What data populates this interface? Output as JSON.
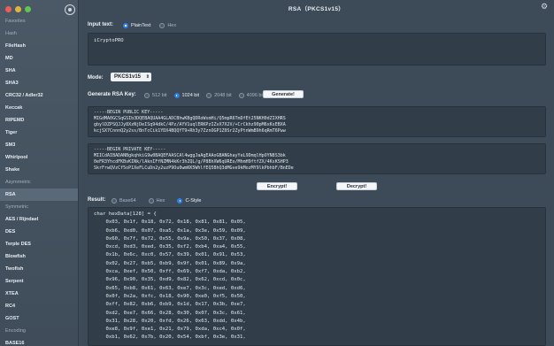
{
  "window": {
    "title": "RSA（PKCS1v15）"
  },
  "sidebar": {
    "sections": [
      {
        "label": "Favorites",
        "items": []
      },
      {
        "label": "Hash",
        "items": [
          "FileHash",
          "MD",
          "SHA",
          "SHA3",
          "CRC32 / Adler32",
          "Keccak",
          "RIPEMD",
          "Tiger",
          "SM3",
          "Whirlpool",
          "Shake"
        ]
      },
      {
        "label": "Asymmetric",
        "items": [
          "RSA"
        ]
      },
      {
        "label": "Symmetric",
        "items": [
          "AES / Rijndael",
          "DES",
          "Terple DES",
          "Blowfish",
          "Twofish",
          "Serpent",
          "XTEA",
          "RC4",
          "GOST"
        ]
      },
      {
        "label": "Encoding",
        "items": [
          "BASE16"
        ]
      }
    ],
    "active": "RSA"
  },
  "input": {
    "label": "Input text:",
    "options": [
      "PlainText",
      "Hex"
    ],
    "selected": "PlainText",
    "value": "iCryptoPRO"
  },
  "mode": {
    "label": "Mode:",
    "value": "PKCS1v15"
  },
  "generate": {
    "label": "Generate RSA Key:",
    "options": [
      "512 bit",
      "1024 bit",
      "2048 bit",
      "4096 bit"
    ],
    "selected": "1024 bit",
    "button": "Generate!"
  },
  "public_key": {
    "lines": [
      "-----BEGIN PUBLIC KEY-----",
      "MIGdMA0GCSqGSIb3DQEBAQUAA4GLADCBhwKBgQDRoWsmHi/Q5mpR6TmDfEt25NKH0dZIXHRS",
      "gbylDZPSQJJy8XzNjDeISq94dkC/4Pz/AYV1uqlERKPzIZvX7X2V/+CrCkhz90pM6xKsEBXA",
      "kcjSX7CnnnQ2y2ss/BnTcCik1YDX4BQQYT9+Rh3y7ZznOGP1Z0Sr2ZyPtnWmB9h6qRmT6Pww"
    ]
  },
  "private_key": {
    "lines": [
      "-----BEGIN PRIVATE KEY-----",
      "MIICdAIBADANBgkqhkiG9w0BAQEFAASCAl4wggJaAgEAAoGBANGhayYeL9DmqlHpOYN8S3bk",
      "0eFR3YhcdFKBvKINk/lAknIFfNZMN4kKr3hZQL/g/P8BhXW6qUREo/MhmH9ftfZX/4KsKSHP3",
      "SkrFrwQVzCf5oP1XeFLCuDn2y2uzP9Ou0wmKK5WhlfEQ5BhQ3dMGve9kMozMY9lkPbhbF/BnEDe"
    ]
  },
  "actions": {
    "encrypt": "Encrypt!",
    "decrypt": "Decrypt!"
  },
  "result": {
    "label": "Result:",
    "options": [
      "Base64",
      "Hex",
      "C-Style"
    ],
    "selected": "C-Style",
    "lines": [
      "char hexData[128] = {",
      "    0x03, 0x1f, 0x18, 0x72, 0x18, 0x81, 0x81, 0x05,",
      "    0xb6, 0xd0, 0x07, 0xa5, 0x1a, 0x3e, 0x59, 0x09,",
      "    0x60, 0x7f, 0x72, 0x55, 0x9a, 0x50, 0x37, 0x08,",
      "    0xcd, 0xd3, 0xed, 0x35, 0xf2, 0xb4, 0xa4, 0x55,",
      "    0x1b, 0x6c, 0xc0, 0x57, 0x39, 0x01, 0x91, 0x53,",
      "    0x02, 0x27, 0xb5, 0xb9, 0x9f, 0x01, 0x89, 0x9a,",
      "    0xca, 0xef, 0x50, 0xff, 0x69, 0xf7, 0xda, 0xb2,",
      "    0x96, 0x90, 0x35, 0xd9, 0x82, 0x62, 0xcd, 0x0c,",
      "    0x65, 0xb8, 0x61, 0x63, 0xe7, 0x3c, 0xed, 0xd6,",
      "    0x0f, 0x2a, 0xfc, 0x18, 0x90, 0xe0, 0xf5, 0x50,",
      "    0xff, 0x82, 0xb6, 0xb9, 0x1d, 0x17, 0x3b, 0xe7,",
      "    0xd2, 0xe7, 0x66, 0x28, 0x30, 0x07, 0x3c, 0x61,",
      "    0x31, 0x28, 0x20, 0xfd, 0x26, 0x63, 0xdd, 0x4b,",
      "    0xe8, 0x9f, 0xe1, 0x21, 0x79, 0xda, 0xc4, 0x0f,",
      "    0xb1, 0x62, 0x7b, 0x20, 0x54, 0xbf, 0x3e, 0x31,"
    ]
  }
}
